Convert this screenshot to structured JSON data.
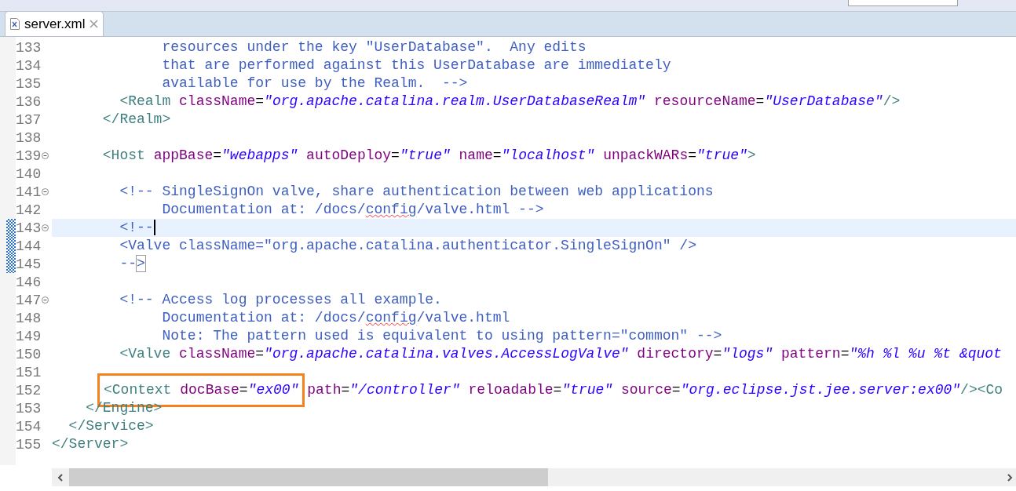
{
  "tab": {
    "title": "server.xml",
    "selected": true
  },
  "lines": [
    {
      "number": "133",
      "fold": false,
      "current": false,
      "marked": false,
      "segments": [
        {
          "kind": "comment",
          "text": "             resources under the key \"UserDatabase\".  Any edits"
        }
      ]
    },
    {
      "number": "134",
      "fold": false,
      "current": false,
      "marked": false,
      "segments": [
        {
          "kind": "comment",
          "text": "             that are performed against this UserDatabase are immediately"
        }
      ]
    },
    {
      "number": "135",
      "fold": false,
      "current": false,
      "marked": false,
      "segments": [
        {
          "kind": "comment",
          "text": "             available for use by the Realm.  -->"
        }
      ]
    },
    {
      "number": "136",
      "fold": false,
      "current": false,
      "marked": false,
      "segments": [
        {
          "kind": "tag",
          "text": "        <Realm"
        },
        {
          "kind": "attr",
          "text": " className"
        },
        {
          "kind": "plain",
          "text": "="
        },
        {
          "kind": "value",
          "text": "\"org.apache.catalina.realm.UserDatabaseRealm\""
        },
        {
          "kind": "attr",
          "text": " resourceName"
        },
        {
          "kind": "plain",
          "text": "="
        },
        {
          "kind": "value",
          "text": "\"UserDatabase\""
        },
        {
          "kind": "tag",
          "text": "/>"
        }
      ]
    },
    {
      "number": "137",
      "fold": false,
      "current": false,
      "marked": false,
      "segments": [
        {
          "kind": "tag",
          "text": "      </Realm>"
        }
      ]
    },
    {
      "number": "138",
      "fold": false,
      "current": false,
      "marked": false
    },
    {
      "number": "139",
      "fold": true,
      "current": false,
      "marked": false,
      "segments": [
        {
          "kind": "tag",
          "text": "      <Host"
        },
        {
          "kind": "attr",
          "text": " appBase"
        },
        {
          "kind": "plain",
          "text": "="
        },
        {
          "kind": "value",
          "text": "\"webapps\""
        },
        {
          "kind": "attr",
          "text": " autoDeploy"
        },
        {
          "kind": "plain",
          "text": "="
        },
        {
          "kind": "value",
          "text": "\"true\""
        },
        {
          "kind": "attr",
          "text": " name"
        },
        {
          "kind": "plain",
          "text": "="
        },
        {
          "kind": "value",
          "text": "\"localhost\""
        },
        {
          "kind": "attr",
          "text": " unpackWARs"
        },
        {
          "kind": "plain",
          "text": "="
        },
        {
          "kind": "value",
          "text": "\"true\""
        },
        {
          "kind": "tag",
          "text": ">"
        }
      ]
    },
    {
      "number": "140",
      "fold": false,
      "current": false,
      "marked": false
    },
    {
      "number": "141",
      "fold": true,
      "current": false,
      "marked": false,
      "segments": [
        {
          "kind": "comment",
          "text": "        <!-- SingleSignOn valve, share authentication between web applications"
        }
      ]
    },
    {
      "number": "142",
      "fold": false,
      "current": false,
      "marked": false,
      "segments": [
        {
          "kind": "comment",
          "text": "             Documentation at: /docs/"
        },
        {
          "kind": "misspelled",
          "text": "config"
        },
        {
          "kind": "comment",
          "text": "/valve.html -->"
        }
      ]
    },
    {
      "number": "143",
      "fold": true,
      "current": true,
      "marked": true,
      "cursor": true,
      "segments": [
        {
          "kind": "comment",
          "text": "        <!--"
        }
      ]
    },
    {
      "number": "144",
      "fold": false,
      "current": false,
      "marked": true,
      "segments": [
        {
          "kind": "comment",
          "text": "        <Valve className=\"org.apache.catalina.authenticator.SingleSignOn\" />"
        }
      ]
    },
    {
      "number": "145",
      "fold": false,
      "current": false,
      "marked": true,
      "segments": [
        {
          "kind": "comment",
          "text": "        --"
        },
        {
          "kind": "match",
          "text": ">"
        }
      ]
    },
    {
      "number": "146",
      "fold": false,
      "current": false,
      "marked": false
    },
    {
      "number": "147",
      "fold": true,
      "current": false,
      "marked": false,
      "segments": [
        {
          "kind": "comment",
          "text": "        <!-- Access log processes all example."
        }
      ]
    },
    {
      "number": "148",
      "fold": false,
      "current": false,
      "marked": false,
      "segments": [
        {
          "kind": "comment",
          "text": "             Documentation at: /docs/"
        },
        {
          "kind": "misspelled",
          "text": "config"
        },
        {
          "kind": "comment",
          "text": "/valve.html"
        }
      ]
    },
    {
      "number": "149",
      "fold": false,
      "current": false,
      "marked": false,
      "segments": [
        {
          "kind": "comment",
          "text": "             Note: The pattern used is equivalent to using pattern=\"common\" -->"
        }
      ]
    },
    {
      "number": "150",
      "fold": false,
      "current": false,
      "marked": false,
      "segments": [
        {
          "kind": "tag",
          "text": "        <Valve"
        },
        {
          "kind": "attr",
          "text": " className"
        },
        {
          "kind": "plain",
          "text": "="
        },
        {
          "kind": "value",
          "text": "\"org.apache.catalina.valves.AccessLogValve\""
        },
        {
          "kind": "attr",
          "text": " directory"
        },
        {
          "kind": "plain",
          "text": "="
        },
        {
          "kind": "value",
          "text": "\"logs\""
        },
        {
          "kind": "attr",
          "text": " pattern"
        },
        {
          "kind": "plain",
          "text": "="
        },
        {
          "kind": "value",
          "text": "\"%h %l %u %t &quot"
        }
      ]
    },
    {
      "number": "151",
      "fold": false,
      "current": false,
      "marked": false
    },
    {
      "number": "152",
      "fold": false,
      "current": false,
      "marked": false,
      "segments": [
        {
          "kind": "tag",
          "text": "<Context",
          "boxed": true
        },
        {
          "kind": "attr",
          "text": " docBase",
          "boxed": true
        },
        {
          "kind": "plain",
          "text": "=",
          "boxed": true
        },
        {
          "kind": "value",
          "text": "\"ex00\"",
          "boxed": true
        },
        {
          "kind": "attr",
          "text": " path"
        },
        {
          "kind": "plain",
          "text": "="
        },
        {
          "kind": "value",
          "text": "\"/controller\""
        },
        {
          "kind": "attr",
          "text": " reloadable"
        },
        {
          "kind": "plain",
          "text": "="
        },
        {
          "kind": "value",
          "text": "\"true\""
        },
        {
          "kind": "attr",
          "text": " source"
        },
        {
          "kind": "plain",
          "text": "="
        },
        {
          "kind": "value",
          "text": "\"org.eclipse.jst.jee.server:ex00\""
        },
        {
          "kind": "tag",
          "text": "/><Co"
        }
      ]
    },
    {
      "number": "153",
      "fold": false,
      "current": false,
      "marked": false,
      "segments": [
        {
          "kind": "tag",
          "text": "    </Engine>"
        }
      ]
    },
    {
      "number": "154",
      "fold": false,
      "current": false,
      "marked": false,
      "segments": [
        {
          "kind": "tag",
          "text": "  </Service>"
        }
      ]
    },
    {
      "number": "155",
      "fold": false,
      "current": false,
      "marked": false,
      "segments": [
        {
          "kind": "tag",
          "text": "</Server>"
        }
      ]
    }
  ]
}
